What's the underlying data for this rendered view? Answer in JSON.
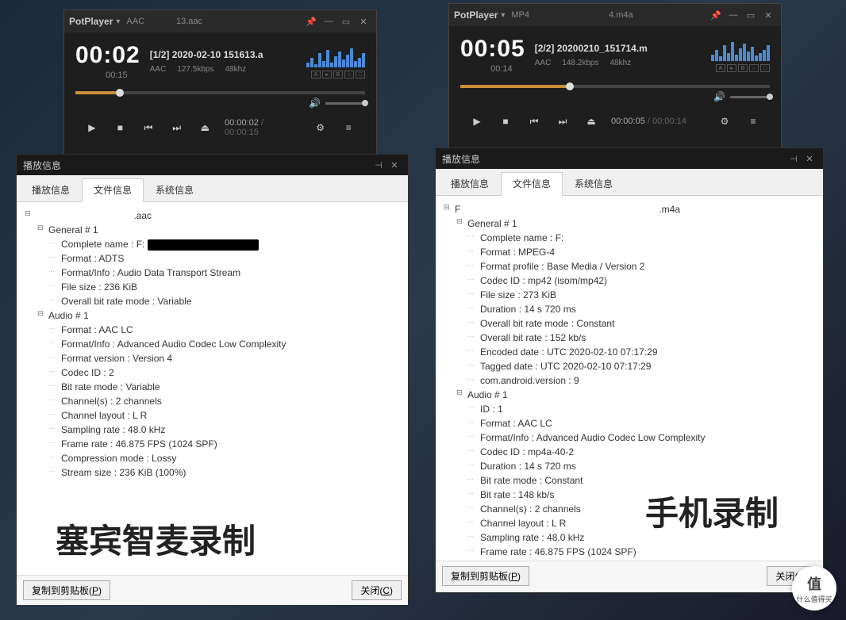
{
  "players": {
    "left": {
      "app": "PotPlayer",
      "tab_label": "AAC",
      "file_suffix": "13.aac",
      "big_time": "00:02",
      "duration_small": "00:15",
      "track_title": "[1/2] 2020-02-10 151613.a",
      "codec": "AAC",
      "bitrate": "127.5kbps",
      "samplerate": "48khz",
      "time_current": "00:00:02",
      "time_total": "00:00:15"
    },
    "right": {
      "app": "PotPlayer",
      "tab_label": "MP4",
      "file_suffix": "4.m4a",
      "big_time": "00:05",
      "duration_small": "00:14",
      "track_title": "[2/2] 20200210_151714.m",
      "codec": "AAC",
      "bitrate": "148.2kbps",
      "samplerate": "48khz",
      "time_current": "00:00:05",
      "time_total": "00:00:14"
    }
  },
  "info": {
    "window_title": "播放信息",
    "tabs": {
      "t1": "播放信息",
      "t2": "文件信息",
      "t3": "系统信息"
    },
    "footer": {
      "copy": "复制到剪贴板(P)",
      "close": "关闭(C)"
    },
    "left": {
      "root_suffix": ".aac",
      "general_header": "General # 1",
      "general": [
        "Complete name : F:",
        "Format : ADTS",
        "Format/Info : Audio Data Transport Stream",
        "File size : 236 KiB",
        "Overall bit rate mode : Variable"
      ],
      "audio_header": "Audio # 1",
      "audio": [
        "Format : AAC LC",
        "Format/Info : Advanced Audio Codec Low Complexity",
        "Format version : Version 4",
        "Codec ID : 2",
        "Bit rate mode : Variable",
        "Channel(s) : 2 channels",
        "Channel layout : L R",
        "Sampling rate : 48.0 kHz",
        "Frame rate : 46.875 FPS (1024 SPF)",
        "Compression mode : Lossy",
        "Stream size : 236 KiB (100%)"
      ]
    },
    "right": {
      "root_suffix": ".m4a",
      "general_header": "General # 1",
      "general": [
        "Complete name : F:",
        "Format : MPEG-4",
        "Format profile : Base Media / Version 2",
        "Codec ID : mp42 (isom/mp42)",
        "File size : 273 KiB",
        "Duration : 14 s 720 ms",
        "Overall bit rate mode : Constant",
        "Overall bit rate : 152 kb/s",
        "Encoded date : UTC 2020-02-10 07:17:29",
        "Tagged date : UTC 2020-02-10 07:17:29",
        "com.android.version : 9"
      ],
      "audio_header": "Audio # 1",
      "audio": [
        "ID : 1",
        "Format : AAC LC",
        "Format/Info : Advanced Audio Codec Low Complexity",
        "Codec ID : mp4a-40-2",
        "Duration : 14 s 720 ms",
        "Bit rate mode : Constant",
        "Bit rate : 148 kb/s",
        "Channel(s) : 2 channels",
        "Channel layout : L R",
        "Sampling rate : 48.0 kHz",
        "Frame rate : 46.875 FPS (1024 SPF)"
      ]
    }
  },
  "watermarks": {
    "w1": "塞宾智麦录制",
    "w2": "手机录制"
  },
  "badge": {
    "char": "值",
    "text": "什么值得买"
  }
}
